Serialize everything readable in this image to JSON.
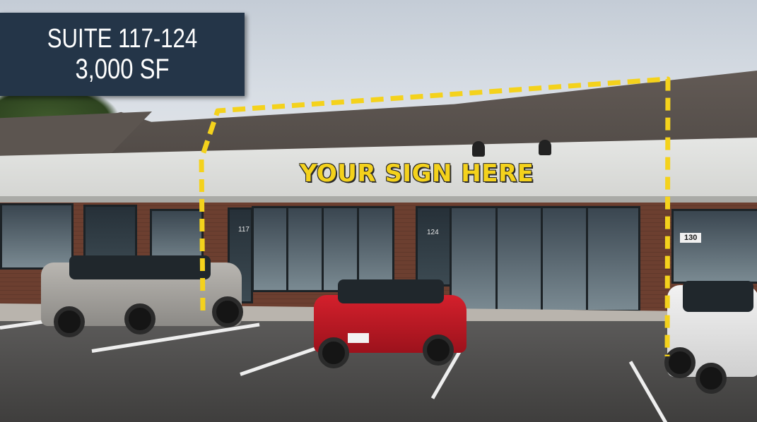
{
  "listing": {
    "suite_line": "SUITE 117-124",
    "size_line": "3,000 SF"
  },
  "signage": {
    "headline": "YOUR SIGN HERE",
    "highlight_color": "#f4d21c"
  },
  "storefront_numbers": {
    "unit_117": "117",
    "unit_124": "124",
    "unit_130": "130"
  },
  "colors": {
    "label_background": "#243548",
    "outline_dashes": "#f4d21c"
  }
}
